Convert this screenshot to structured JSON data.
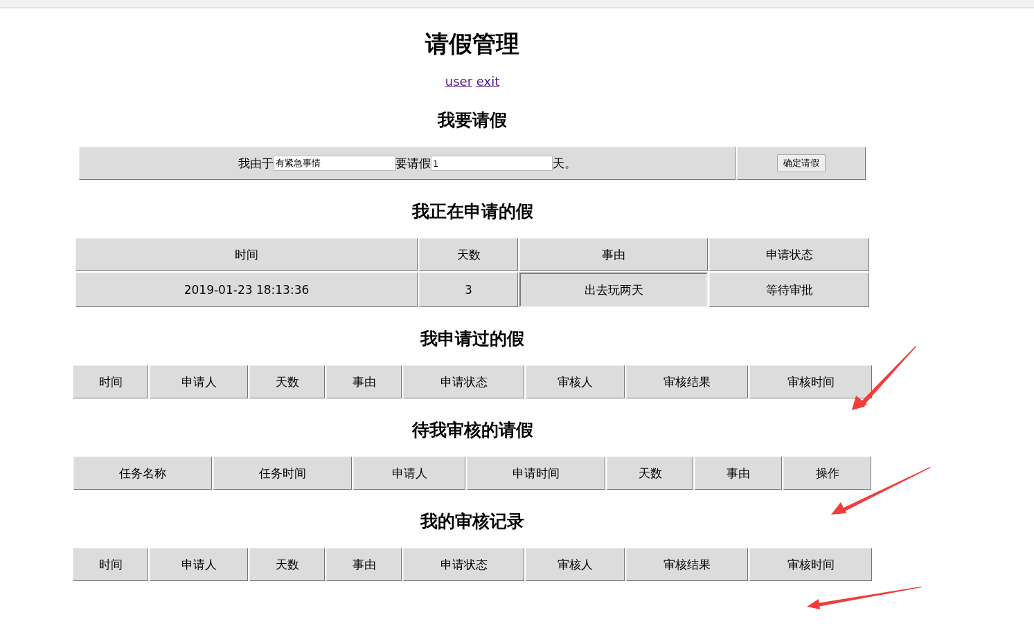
{
  "title": "请假管理",
  "links": [
    {
      "text": "user"
    },
    {
      "text": "exit"
    }
  ],
  "leave_form": {
    "heading": "我要请假",
    "prefix": "我由于",
    "reason_value": "有紧急事情",
    "middle": "要请假",
    "days_value": "1",
    "suffix": "天。",
    "submit": "确定请假"
  },
  "sections": [
    {
      "heading": "我正在申请的假",
      "columns": [
        "时间",
        "天数",
        "事由",
        "申请状态"
      ],
      "rows": [
        [
          {
            "text": "2019-01-23 18:13:36",
            "kind": "plain"
          },
          {
            "text": "3",
            "kind": "plain"
          },
          {
            "text": "出去玩两天",
            "kind": "sunken"
          },
          {
            "text": "等待审批",
            "kind": "plain"
          }
        ]
      ]
    },
    {
      "heading": "我申请过的假",
      "columns": [
        "时间",
        "申请人",
        "天数",
        "事由",
        "申请状态",
        "审核人",
        "审核结果",
        "审核时间"
      ]
    },
    {
      "heading": "待我审核的请假",
      "columns": [
        "任务名称",
        "任务时间",
        "申请人",
        "申请时间",
        "天数",
        "事由",
        "操作"
      ]
    },
    {
      "heading": "我的审核记录",
      "columns": [
        "时间",
        "申请人",
        "天数",
        "事由",
        "申请状态",
        "审核人",
        "审核结果",
        "审核时间"
      ]
    }
  ]
}
